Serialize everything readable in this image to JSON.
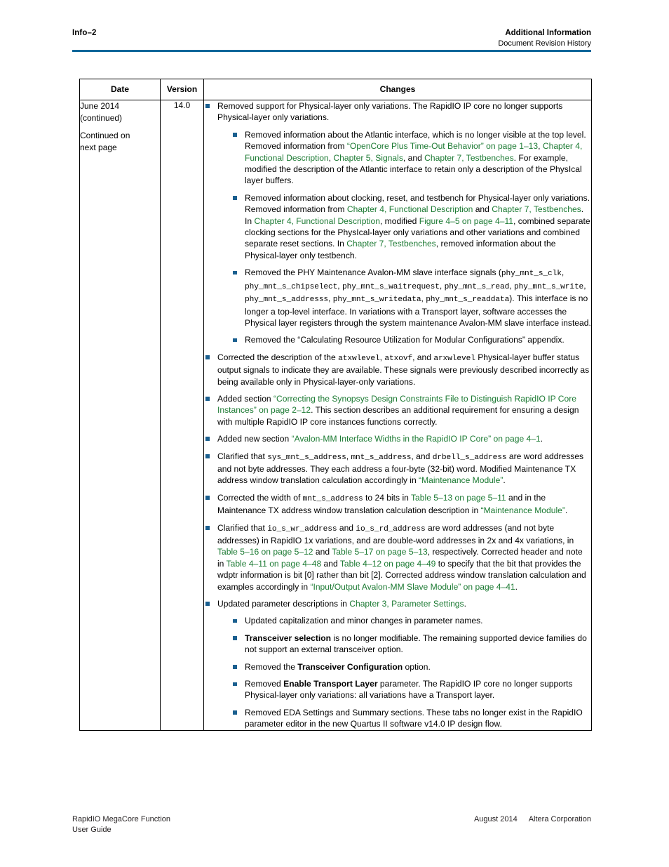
{
  "header": {
    "page_number": "Info–2",
    "title": "Additional Information",
    "subtitle": "Document Revision History",
    "rule_color": "#0b6699"
  },
  "table": {
    "columns": {
      "date": "Date",
      "version": "Version",
      "changes": "Changes"
    },
    "row": {
      "date_line1": "June 2014",
      "date_line2": "(continued)",
      "date_line3": "Continued on",
      "date_line4": "next page",
      "version": "14.0"
    }
  },
  "colors": {
    "link_green": "#1c7a33",
    "bullet_blue": "#1a5f8f",
    "rule_blue": "#0b6699"
  },
  "changes": {
    "b1": {
      "t1": "Removed support for Physical-layer only variations. The RapidIO IP core no longer supports Physical-layer only variations."
    },
    "b1a": {
      "t1": "Removed information about the Atlantic interface, which is no longer visible at the top level. Removed information from ",
      "l1": "“OpenCore Plus Time-Out Behavior” on page 1–13",
      "t2": ", ",
      "l2": "Chapter 4, Functional Description",
      "t3": ", ",
      "l3": "Chapter 5, Signals",
      "t4": ", and ",
      "l4": "Chapter 7, Testbenches",
      "t5": ". For example, modified the description of the Atlantic interface to retain only a description of the PhysIcal layer buffers."
    },
    "b1b": {
      "t1": "Removed information about clocking, reset, and testbench for Physical-layer only variations. Removed information from ",
      "l1": "Chapter 4, Functional Description",
      "t2": " and ",
      "l2": "Chapter 7, Testbenches",
      "t3": ". In ",
      "l3": "Chapter 4, Functional Description",
      "t4": ", modified ",
      "l4": "Figure 4–5 on page 4–11",
      "t5": ", combined separate clocking sections for the PhysIcal-layer only variations and other variations and combined separate reset sections. In ",
      "l5": "Chapter 7, Testbenches",
      "t6": ", removed information about the Physical-layer only testbench."
    },
    "b1c": {
      "t1": "Removed the PHY Maintenance Avalon-MM slave interface signals (",
      "m1": "phy_mnt_s_clk",
      "t2": ", ",
      "m2": "phy_mnt_s_chipselect",
      "t3": ", ",
      "m3": "phy_mnt_s_waitrequest",
      "t4": ", ",
      "m4": "phy_mnt_s_read",
      "t5": ", ",
      "m5": "phy_mnt_s_write",
      "t6": ", ",
      "m6": "phy_mnt_s_addresss",
      "t7": ", ",
      "m7": "phy_mnt_s_writedata",
      "t8": ", ",
      "m8": "phy_mnt_s_readdata",
      "t9": "). This interface is no longer a top-level interface. In variations with a Transport layer, software accesses the Physical layer registers through the system maintenance Avalon-MM slave interface instead."
    },
    "b1d": {
      "t1": "Removed the “Calculating Resource Utilization for Modular Configurations” appendix."
    },
    "b2": {
      "t1": "Corrected the description of the ",
      "m1": "atxwlevel",
      "t2": ", ",
      "m2": "atxovf",
      "t3": ", and ",
      "m3": "arxwlevel",
      "t4": " Physical-layer buffer status output signals to indicate they are available. These signals were previously described incorrectly as being available only in Physical-layer-only variations."
    },
    "b3": {
      "t1": "Added section ",
      "l1": "“Correcting the Synopsys Design Constraints File to Distinguish RapidIO IP Core Instances” on page 2–12",
      "t2": ". This section describes an additional requirement for ensuring a design with multiple RapidIO IP core instances functions correctly."
    },
    "b4": {
      "t1": "Added new section ",
      "l1": "“Avalon-MM Interface Widths in the RapidIO IP Core” on page 4–1",
      "t2": "."
    },
    "b5": {
      "t1": "Clarified that ",
      "m1": "sys_mnt_s_address",
      "t2": ", ",
      "m2": "mnt_s_address",
      "t3": ", and ",
      "m3": "drbell_s_address",
      "t4": " are word addresses and not byte addresses. They each address a four-byte (32-bit) word. Modified Maintenance TX address window translation calculation accordingly in ",
      "l1": "“Maintenance Module”",
      "t5": "."
    },
    "b6": {
      "t1": "Corrected the width of ",
      "m1": "mnt_s_address",
      "t2": " to 24 bits in ",
      "l1": "Table 5–13 on page 5–11",
      "t3": " and in the Maintenance TX address window translation calculation description in ",
      "l2": "“Maintenance Module”",
      "t4": "."
    },
    "b7": {
      "t1": "Clarified that ",
      "m1": "io_s_wr_address",
      "t2": " and ",
      "m2": "io_s_rd_address",
      "t3": " are word addresses (and not byte addresses) in RapidIO 1x variations, and are double-word addresses in 2x and 4x variations, in ",
      "l1": "Table 5–16 on page 5–12",
      "t4": " and ",
      "l2": "Table 5–17 on page 5–13",
      "t5": ", respectively. Corrected header and note in ",
      "l3": "Table 4–11 on page 4–48",
      "t6": " and ",
      "l4": "Table 4–12 on page 4–49",
      "t7": " to specify that the bit that provides the wdptr information is bit [0] rather than bit [2]. Corrected address window translation calculation and examples accordingly in ",
      "l5": "“Input/Output Avalon-MM Slave Module” on page 4–41",
      "t8": "."
    },
    "b8": {
      "t1": "Updated parameter descriptions in ",
      "l1": "Chapter 3, Parameter Settings",
      "t2": "."
    },
    "b8a": {
      "t1": "Updated capitalization and minor changes in parameter names."
    },
    "b8b": {
      "bold1": "Transceiver selection",
      "t1": " is no longer modifiable. The remaining supported device families do not support an external transceiver option."
    },
    "b8c": {
      "t1": "Removed the ",
      "bold1": "Transceiver Configuration",
      "t2": " option."
    },
    "b8d": {
      "t1": "Removed ",
      "bold1": "Enable Transport Layer",
      "t2": " parameter. The RapidIO IP core no longer supports Physical-layer only variations: all variations have a Transport layer."
    },
    "b8e": {
      "t1": "Removed EDA Settings and Summary sections. These tabs no longer exist in the RapidIO parameter editor in the new Quartus II software v14.0 IP design flow."
    }
  },
  "footer": {
    "left_line1": "RapidIO MegaCore Function",
    "left_line2": "User Guide",
    "right_date": "August 2014",
    "right_company": "Altera Corporation"
  }
}
